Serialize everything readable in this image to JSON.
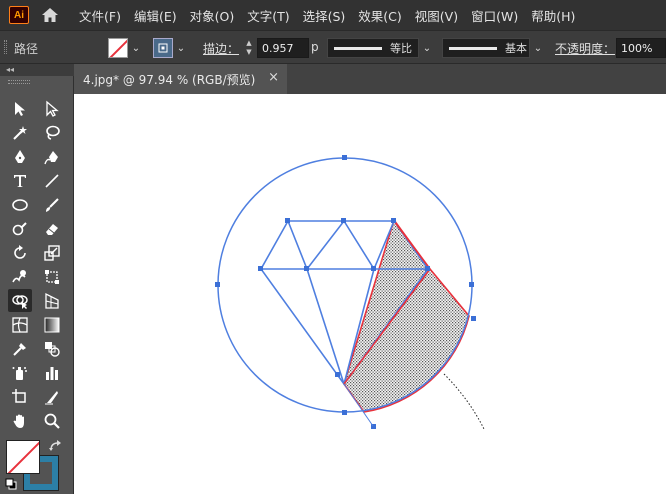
{
  "app": {
    "logo_text": "Ai"
  },
  "menu": [
    "文件(F)",
    "编辑(E)",
    "对象(O)",
    "文字(T)",
    "选择(S)",
    "效果(C)",
    "视图(V)",
    "窗口(W)",
    "帮助(H)"
  ],
  "controlbar": {
    "selection_type": "路径",
    "stroke_label": "描边：",
    "stroke_weight": "0.957",
    "stroke_unit": "p",
    "profile_label": "等比",
    "brush_label": "基本",
    "opacity_label": "不透明度：",
    "opacity_value": "100%"
  },
  "document": {
    "tab_title": "4.jpg* @ 97.94 % (RGB/预览)",
    "close_symbol": "×"
  },
  "toolbar": {
    "collapse_symbol": "◂◂"
  },
  "colors": {
    "path_blue": "#4f7fe0",
    "highlight_red": "#e8323c",
    "anchor_blue": "#3b6fd6",
    "stroke_swatch": "#2c7fa6"
  }
}
